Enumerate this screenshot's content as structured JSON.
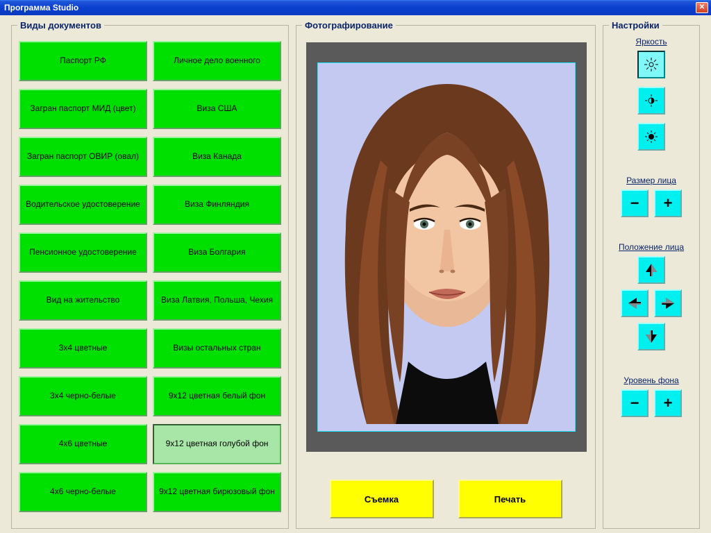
{
  "window": {
    "title": "Программа Studio"
  },
  "docs": {
    "legend": "Виды документов",
    "items": [
      "Паспорт РФ",
      "Личное дело военного",
      "Загран паспорт МИД (цвет)",
      "Виза США",
      "Загран паспорт ОВИР (овал)",
      "Виза Канада",
      "Водительское удостоверение",
      "Виза Финляндия",
      "Пенсионное удостоверение",
      "Виза Болгария",
      "Вид на жительство",
      "Виза Латвия, Польша, Чехия",
      "3х4 цветные",
      "Визы остальных стран",
      "3х4 черно-белые",
      "9х12 цветная белый фон",
      "4х6 цветные",
      "9х12 цветная голубой фон",
      "4х6 черно-белые",
      "9х12 цветная бирюзовый фон"
    ],
    "selected_index": 17
  },
  "photo": {
    "legend": "Фотографирование",
    "capture_label": "Съемка",
    "print_label": "Печать"
  },
  "settings": {
    "legend": "Настройки",
    "brightness_label": "Яркость",
    "brightness_selected": 0,
    "face_size_label": "Размер лица",
    "face_pos_label": "Положение лица",
    "bg_level_label": "Уровень фона"
  }
}
